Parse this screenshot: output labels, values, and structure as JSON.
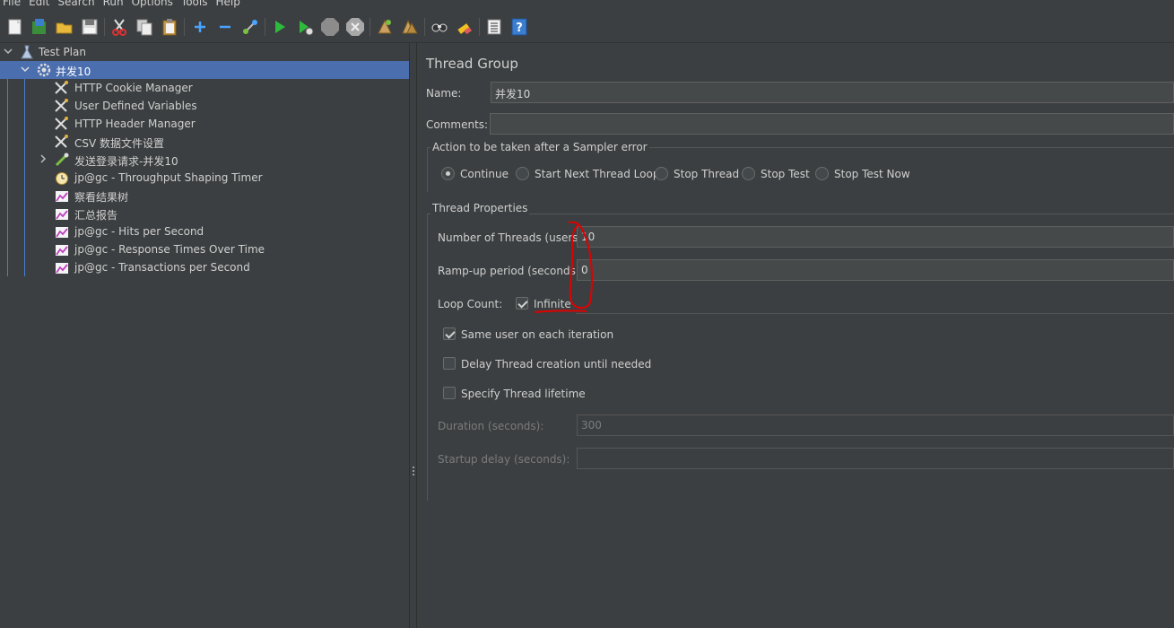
{
  "menu": {
    "file": "File",
    "edit": "Edit",
    "search": "Search",
    "run": "Run",
    "options": "Options",
    "tools": "Tools",
    "help": "Help"
  },
  "toolbar": {
    "icons": [
      "new-icon",
      "templates-icon",
      "open-icon",
      "save-icon",
      "cut-icon",
      "copy-icon",
      "paste-icon",
      "expand-icon",
      "collapse-icon",
      "toggle-icon",
      "start-icon",
      "start-no-pauses-icon",
      "stop-icon",
      "shutdown-icon",
      "clear-icon",
      "clear-all-icon",
      "search-icon",
      "reset-search-icon",
      "function-helper-icon",
      "help-icon"
    ]
  },
  "tree": {
    "items": [
      {
        "label": "Test Plan",
        "icon": "test-plan-icon"
      },
      {
        "label": "并发10",
        "icon": "thread-group-gear-icon"
      },
      {
        "label": "HTTP Cookie Manager",
        "icon": "config-element-icon"
      },
      {
        "label": "User Defined Variables",
        "icon": "config-element-icon"
      },
      {
        "label": "HTTP Header Manager",
        "icon": "config-element-icon"
      },
      {
        "label": "CSV 数据文件设置",
        "icon": "config-element-icon"
      },
      {
        "label": "发送登录请求-并发10",
        "icon": "sampler-pipette-icon"
      },
      {
        "label": "jp@gc - Throughput Shaping Timer",
        "icon": "timer-icon"
      },
      {
        "label": "察看结果树",
        "icon": "listener-chart-icon"
      },
      {
        "label": "汇总报告",
        "icon": "listener-chart-icon"
      },
      {
        "label": "jp@gc - Hits per Second",
        "icon": "listener-chart-icon"
      },
      {
        "label": "jp@gc - Response Times Over Time",
        "icon": "listener-chart-icon"
      },
      {
        "label": "jp@gc - Transactions per Second",
        "icon": "listener-chart-icon"
      }
    ]
  },
  "panel": {
    "title": "Thread Group",
    "name_label": "Name:",
    "name_value": "并发10",
    "comments_label": "Comments:",
    "comments_value": "",
    "error_action": {
      "title": "Action to be taken after a Sampler error",
      "options": [
        "Continue",
        "Start Next Thread Loop",
        "Stop Thread",
        "Stop Test",
        "Stop Test Now"
      ],
      "selected": "Continue"
    },
    "thread_props": {
      "title": "Thread Properties",
      "threads_label": "Number of Threads (users):",
      "threads_value": "10",
      "rampup_label": "Ramp-up period (seconds):",
      "rampup_value": "0",
      "loop_label": "Loop Count:",
      "infinite_label": "Infinite",
      "infinite_checked": true,
      "same_user_label": "Same user on each iteration",
      "same_user_checked": true,
      "delay_label": "Delay Thread creation until needed",
      "delay_checked": false,
      "lifetime_label": "Specify Thread lifetime",
      "lifetime_checked": false,
      "duration_label": "Duration (seconds):",
      "duration_value": "300",
      "startup_label": "Startup delay (seconds):",
      "startup_value": ""
    }
  },
  "annotation_color": "#e00000"
}
